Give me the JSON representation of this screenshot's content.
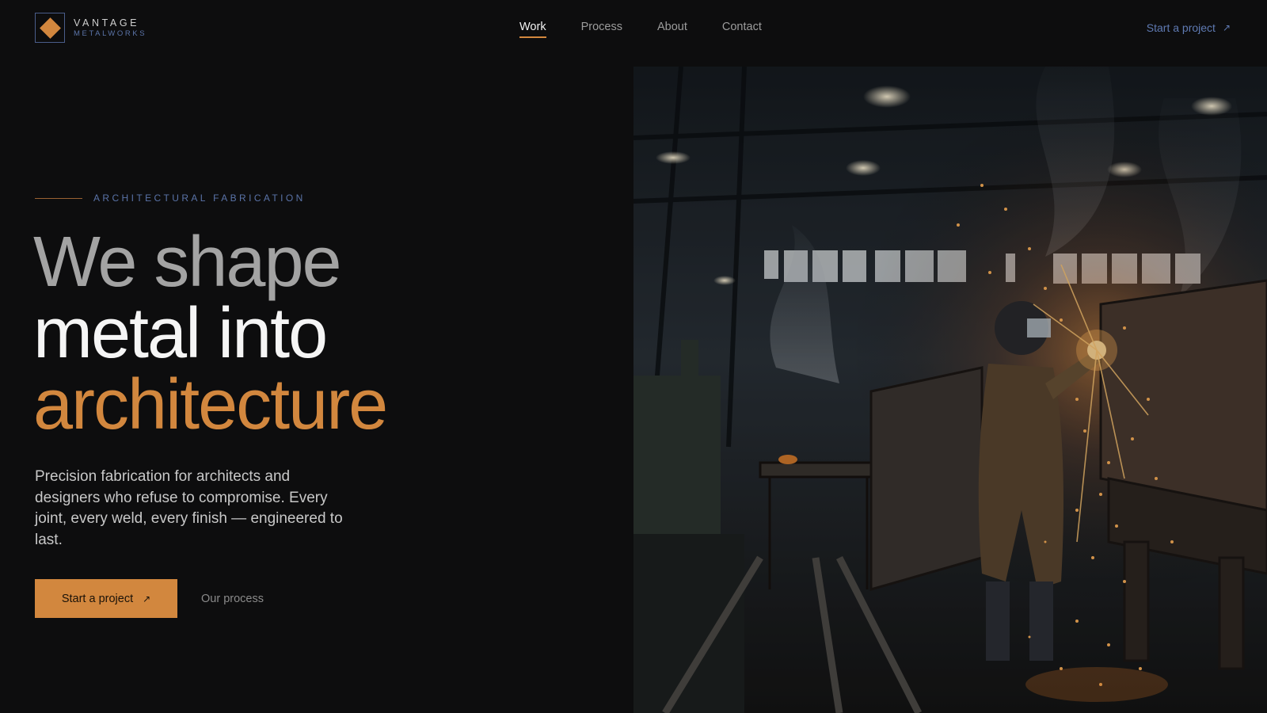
{
  "brand": {
    "name_line1": "VANTAGE",
    "name_line2": "METALWORKS",
    "logo_icon": "diamond-icon",
    "accent_color": "#d2873e",
    "secondary_color": "#5b74a8"
  },
  "nav": {
    "items": [
      {
        "label": "Work",
        "active": true
      },
      {
        "label": "Process",
        "active": false
      },
      {
        "label": "About",
        "active": false
      },
      {
        "label": "Contact",
        "active": false
      }
    ]
  },
  "header": {
    "cta_label": "Start a project",
    "cta_icon": "arrow-up-right-icon"
  },
  "hero": {
    "eyebrow": "ARCHITECTURAL FABRICATION",
    "headline_line1": "We shape",
    "headline_line2": "metal into",
    "headline_line3": "architecture",
    "lead": "Precision fabrication for architects and designers who refuse to compromise. Every joint, every weld, every finish — engineered to last.",
    "primary_cta": "Start a project",
    "secondary_cta": "Our process"
  }
}
